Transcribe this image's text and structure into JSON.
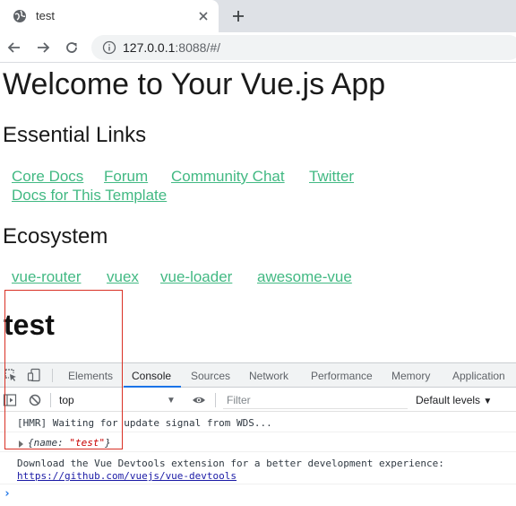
{
  "browser": {
    "tab_title": "test",
    "url_host": "127.0.0.1",
    "url_rest": ":8088/#/"
  },
  "page": {
    "title": "Welcome to Your Vue.js App",
    "essential_links_heading": "Essential Links",
    "essential_links": [
      "Core Docs",
      "Forum",
      "Community Chat",
      "Twitter",
      "Docs for This Template"
    ],
    "ecosystem_heading": "Ecosystem",
    "ecosystem_links": [
      "vue-router",
      "vuex",
      "vue-loader",
      "awesome-vue"
    ],
    "result_heading": "test"
  },
  "devtools": {
    "tabs": [
      "Elements",
      "Console",
      "Sources",
      "Network",
      "Performance",
      "Memory",
      "Application"
    ],
    "active_tab": "Console",
    "context": "top",
    "filter_placeholder": "Filter",
    "levels": "Default levels",
    "messages": {
      "hmr": "[HMR] Waiting for update signal from WDS...",
      "object_open": "{name: ",
      "object_value": "\"test\"",
      "object_close": "}",
      "devtools_note": "Download the Vue Devtools extension for a better development experience:",
      "devtools_link": "https://github.com/vuejs/vue-devtools"
    },
    "prompt": "›"
  },
  "colors": {
    "link": "#42b983",
    "highlight_border": "#d93025",
    "active_tab_underline": "#1a73e8"
  }
}
